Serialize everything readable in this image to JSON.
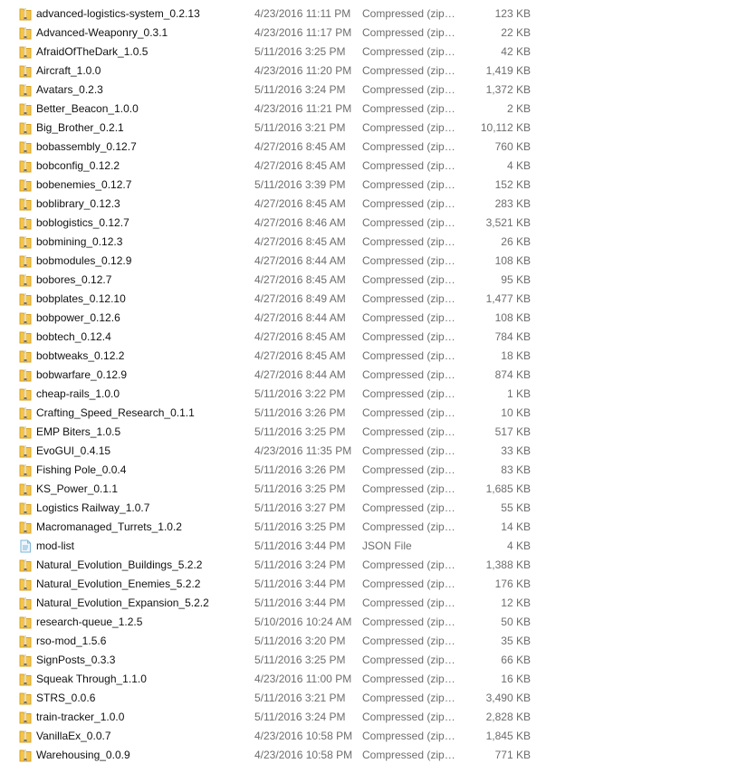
{
  "colors": {
    "zip_folder_yellow": "#f4c44a",
    "zip_folder_dark": "#d9a21d",
    "zip_stripe": "#6f6f6f",
    "json_file_blue": "#7fb6d9",
    "text_primary": "#111111",
    "text_secondary": "#6d6d6d"
  },
  "files": [
    {
      "name": "advanced-logistics-system_0.2.13",
      "modified": "4/23/2016 11:11 PM",
      "type": "Compressed (zipp...",
      "size": "123 KB",
      "icon": "zip-folder-icon"
    },
    {
      "name": "Advanced-Weaponry_0.3.1",
      "modified": "4/23/2016 11:17 PM",
      "type": "Compressed (zipp...",
      "size": "22 KB",
      "icon": "zip-folder-icon"
    },
    {
      "name": "AfraidOfTheDark_1.0.5",
      "modified": "5/11/2016 3:25 PM",
      "type": "Compressed (zipp...",
      "size": "42 KB",
      "icon": "zip-folder-icon"
    },
    {
      "name": "Aircraft_1.0.0",
      "modified": "4/23/2016 11:20 PM",
      "type": "Compressed (zipp...",
      "size": "1,419 KB",
      "icon": "zip-folder-icon"
    },
    {
      "name": "Avatars_0.2.3",
      "modified": "5/11/2016 3:24 PM",
      "type": "Compressed (zipp...",
      "size": "1,372 KB",
      "icon": "zip-folder-icon"
    },
    {
      "name": "Better_Beacon_1.0.0",
      "modified": "4/23/2016 11:21 PM",
      "type": "Compressed (zipp...",
      "size": "2 KB",
      "icon": "zip-folder-icon"
    },
    {
      "name": "Big_Brother_0.2.1",
      "modified": "5/11/2016 3:21 PM",
      "type": "Compressed (zipp...",
      "size": "10,112 KB",
      "icon": "zip-folder-icon"
    },
    {
      "name": "bobassembly_0.12.7",
      "modified": "4/27/2016 8:45 AM",
      "type": "Compressed (zipp...",
      "size": "760 KB",
      "icon": "zip-folder-icon"
    },
    {
      "name": "bobconfig_0.12.2",
      "modified": "4/27/2016 8:45 AM",
      "type": "Compressed (zipp...",
      "size": "4 KB",
      "icon": "zip-folder-icon"
    },
    {
      "name": "bobenemies_0.12.7",
      "modified": "5/11/2016 3:39 PM",
      "type": "Compressed (zipp...",
      "size": "152 KB",
      "icon": "zip-folder-icon"
    },
    {
      "name": "boblibrary_0.12.3",
      "modified": "4/27/2016 8:45 AM",
      "type": "Compressed (zipp...",
      "size": "283 KB",
      "icon": "zip-folder-icon"
    },
    {
      "name": "boblogistics_0.12.7",
      "modified": "4/27/2016 8:46 AM",
      "type": "Compressed (zipp...",
      "size": "3,521 KB",
      "icon": "zip-folder-icon"
    },
    {
      "name": "bobmining_0.12.3",
      "modified": "4/27/2016 8:45 AM",
      "type": "Compressed (zipp...",
      "size": "26 KB",
      "icon": "zip-folder-icon"
    },
    {
      "name": "bobmodules_0.12.9",
      "modified": "4/27/2016 8:44 AM",
      "type": "Compressed (zipp...",
      "size": "108 KB",
      "icon": "zip-folder-icon"
    },
    {
      "name": "bobores_0.12.7",
      "modified": "4/27/2016 8:45 AM",
      "type": "Compressed (zipp...",
      "size": "95 KB",
      "icon": "zip-folder-icon"
    },
    {
      "name": "bobplates_0.12.10",
      "modified": "4/27/2016 8:49 AM",
      "type": "Compressed (zipp...",
      "size": "1,477 KB",
      "icon": "zip-folder-icon"
    },
    {
      "name": "bobpower_0.12.6",
      "modified": "4/27/2016 8:44 AM",
      "type": "Compressed (zipp...",
      "size": "108 KB",
      "icon": "zip-folder-icon"
    },
    {
      "name": "bobtech_0.12.4",
      "modified": "4/27/2016 8:45 AM",
      "type": "Compressed (zipp...",
      "size": "784 KB",
      "icon": "zip-folder-icon"
    },
    {
      "name": "bobtweaks_0.12.2",
      "modified": "4/27/2016 8:45 AM",
      "type": "Compressed (zipp...",
      "size": "18 KB",
      "icon": "zip-folder-icon"
    },
    {
      "name": "bobwarfare_0.12.9",
      "modified": "4/27/2016 8:44 AM",
      "type": "Compressed (zipp...",
      "size": "874 KB",
      "icon": "zip-folder-icon"
    },
    {
      "name": "cheap-rails_1.0.0",
      "modified": "5/11/2016 3:22 PM",
      "type": "Compressed (zipp...",
      "size": "1 KB",
      "icon": "zip-folder-icon"
    },
    {
      "name": "Crafting_Speed_Research_0.1.1",
      "modified": "5/11/2016 3:26 PM",
      "type": "Compressed (zipp...",
      "size": "10 KB",
      "icon": "zip-folder-icon"
    },
    {
      "name": "EMP Biters_1.0.5",
      "modified": "5/11/2016 3:25 PM",
      "type": "Compressed (zipp...",
      "size": "517 KB",
      "icon": "zip-folder-icon"
    },
    {
      "name": "EvoGUI_0.4.15",
      "modified": "4/23/2016 11:35 PM",
      "type": "Compressed (zipp...",
      "size": "33 KB",
      "icon": "zip-folder-icon"
    },
    {
      "name": "Fishing Pole_0.0.4",
      "modified": "5/11/2016 3:26 PM",
      "type": "Compressed (zipp...",
      "size": "83 KB",
      "icon": "zip-folder-icon"
    },
    {
      "name": "KS_Power_0.1.1",
      "modified": "5/11/2016 3:25 PM",
      "type": "Compressed (zipp...",
      "size": "1,685 KB",
      "icon": "zip-folder-icon"
    },
    {
      "name": "Logistics Railway_1.0.7",
      "modified": "5/11/2016 3:27 PM",
      "type": "Compressed (zipp...",
      "size": "55 KB",
      "icon": "zip-folder-icon"
    },
    {
      "name": "Macromanaged_Turrets_1.0.2",
      "modified": "5/11/2016 3:25 PM",
      "type": "Compressed (zipp...",
      "size": "14 KB",
      "icon": "zip-folder-icon"
    },
    {
      "name": "mod-list",
      "modified": "5/11/2016 3:44 PM",
      "type": "JSON File",
      "size": "4 KB",
      "icon": "json-file-icon"
    },
    {
      "name": "Natural_Evolution_Buildings_5.2.2",
      "modified": "5/11/2016 3:24 PM",
      "type": "Compressed (zipp...",
      "size": "1,388 KB",
      "icon": "zip-folder-icon"
    },
    {
      "name": "Natural_Evolution_Enemies_5.2.2",
      "modified": "5/11/2016 3:44 PM",
      "type": "Compressed (zipp...",
      "size": "176 KB",
      "icon": "zip-folder-icon"
    },
    {
      "name": "Natural_Evolution_Expansion_5.2.2",
      "modified": "5/11/2016 3:44 PM",
      "type": "Compressed (zipp...",
      "size": "12 KB",
      "icon": "zip-folder-icon"
    },
    {
      "name": "research-queue_1.2.5",
      "modified": "5/10/2016 10:24 AM",
      "type": "Compressed (zipp...",
      "size": "50 KB",
      "icon": "zip-folder-icon"
    },
    {
      "name": "rso-mod_1.5.6",
      "modified": "5/11/2016 3:20 PM",
      "type": "Compressed (zipp...",
      "size": "35 KB",
      "icon": "zip-folder-icon"
    },
    {
      "name": "SignPosts_0.3.3",
      "modified": "5/11/2016 3:25 PM",
      "type": "Compressed (zipp...",
      "size": "66 KB",
      "icon": "zip-folder-icon"
    },
    {
      "name": "Squeak Through_1.1.0",
      "modified": "4/23/2016 11:00 PM",
      "type": "Compressed (zipp...",
      "size": "16 KB",
      "icon": "zip-folder-icon"
    },
    {
      "name": "STRS_0.0.6",
      "modified": "5/11/2016 3:21 PM",
      "type": "Compressed (zipp...",
      "size": "3,490 KB",
      "icon": "zip-folder-icon"
    },
    {
      "name": "train-tracker_1.0.0",
      "modified": "5/11/2016 3:24 PM",
      "type": "Compressed (zipp...",
      "size": "2,828 KB",
      "icon": "zip-folder-icon"
    },
    {
      "name": "VanillaEx_0.0.7",
      "modified": "4/23/2016 10:58 PM",
      "type": "Compressed (zipp...",
      "size": "1,845 KB",
      "icon": "zip-folder-icon"
    },
    {
      "name": "Warehousing_0.0.9",
      "modified": "4/23/2016 10:58 PM",
      "type": "Compressed (zipp...",
      "size": "771 KB",
      "icon": "zip-folder-icon"
    }
  ]
}
